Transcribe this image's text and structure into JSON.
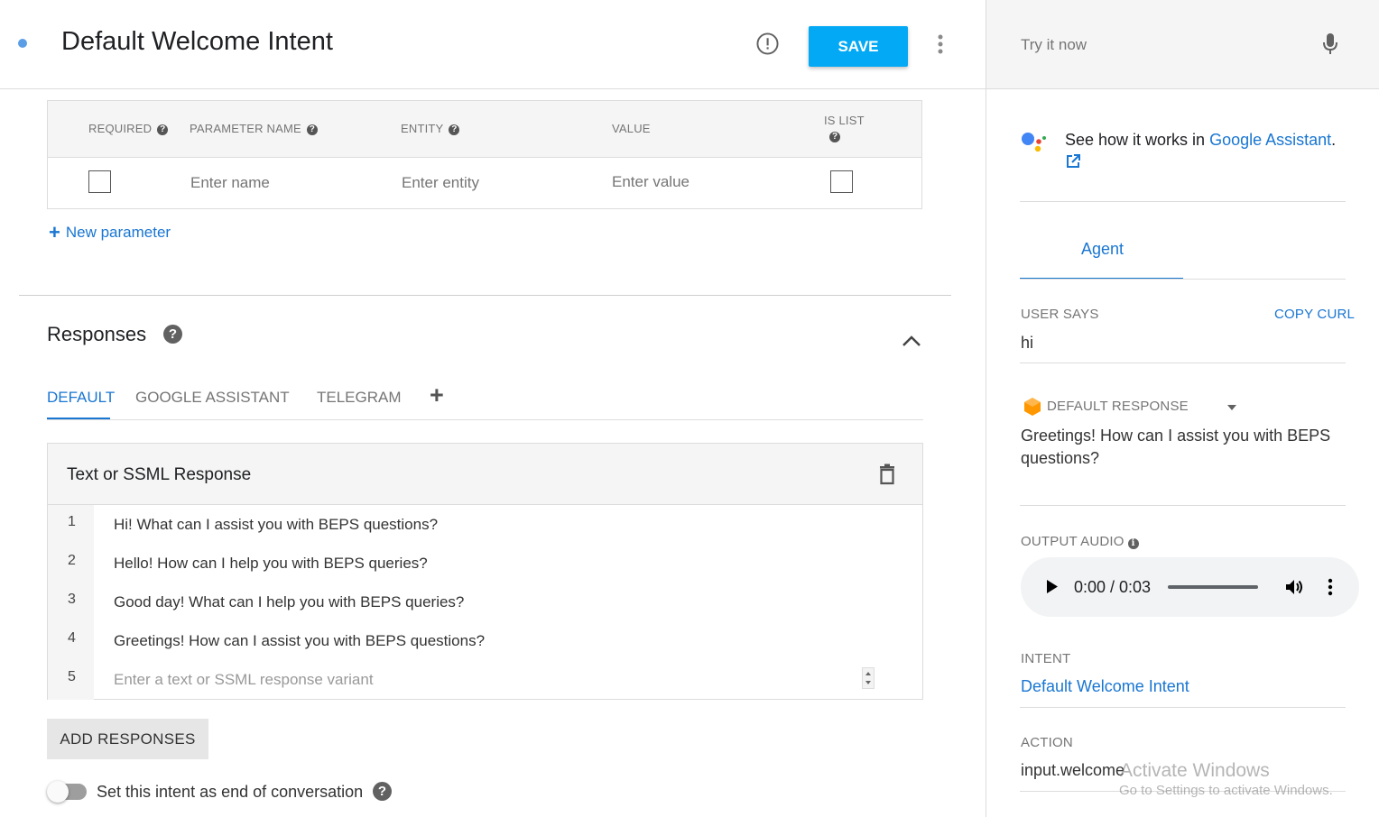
{
  "header": {
    "title": "Default Welcome Intent",
    "save_label": "SAVE"
  },
  "params": {
    "columns": [
      "REQUIRED",
      "PARAMETER NAME",
      "ENTITY",
      "VALUE",
      "IS LIST"
    ],
    "name_placeholder": "Enter name",
    "entity_placeholder": "Enter entity",
    "value_placeholder": "Enter value",
    "new_parameter_label": "New parameter"
  },
  "responses": {
    "title": "Responses",
    "tabs": [
      "DEFAULT",
      "GOOGLE ASSISTANT",
      "TELEGRAM"
    ],
    "active_tab": "DEFAULT",
    "box_title": "Text or SSML Response",
    "rows": [
      {
        "num": "1",
        "text": "Hi! What can I assist you with BEPS questions?"
      },
      {
        "num": "2",
        "text": "Hello! How can I help you with BEPS queries?"
      },
      {
        "num": "3",
        "text": "Good day! What can I help you with BEPS queries?"
      },
      {
        "num": "4",
        "text": "Greetings! How can I assist you with BEPS questions?"
      }
    ],
    "new_row_num": "5",
    "new_row_placeholder": "Enter a text or SSML response variant",
    "add_responses_label": "ADD RESPONSES",
    "end_conversation_label": "Set this intent as end of conversation"
  },
  "try_panel": {
    "try_placeholder": "Try it now",
    "see_how_prefix": "See how it works in ",
    "see_how_link": "Google Assistant",
    "see_how_suffix": ".",
    "agent_tab": "Agent",
    "user_says_label": "USER SAYS",
    "copy_curl_label": "COPY CURL",
    "user_says_value": "hi",
    "default_response_label": "DEFAULT RESPONSE",
    "default_response_value": "Greetings! How can I assist you with BEPS questions?",
    "output_audio_label": "OUTPUT AUDIO",
    "audio_time": "0:00 / 0:03",
    "intent_label": "INTENT",
    "intent_value": "Default Welcome Intent",
    "action_label": "ACTION",
    "action_value": "input.welcome"
  },
  "watermark": {
    "line1": "Activate Windows",
    "line2": "Go to Settings to activate Windows."
  },
  "colors": {
    "accent": "#03a9f4",
    "link": "#1976d2",
    "status_dot": "#5c9ee6"
  }
}
